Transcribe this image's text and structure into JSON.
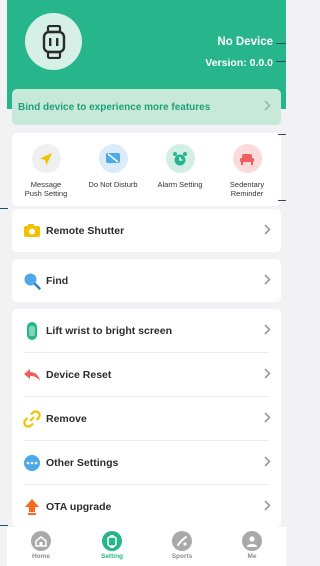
{
  "device": {
    "name": "No Device",
    "version": "Version: 0.0.0"
  },
  "bind_banner": {
    "text": "Bind device to experience more features"
  },
  "quick_actions": [
    {
      "label_line1": "Message",
      "label_line2": "Push Setting",
      "icon": "send-icon",
      "color": "#f2c200"
    },
    {
      "label_line1": "Do Not Disturb",
      "label_line2": "",
      "icon": "no-message-icon",
      "color": "#4da9e8"
    },
    {
      "label_line1": "Alarm Setting",
      "label_line2": "",
      "icon": "alarm-clock-icon",
      "color": "#27b58c"
    },
    {
      "label_line1": "Sedentary",
      "label_line2": "Reminder",
      "icon": "armchair-icon",
      "color": "#ef5f5f"
    }
  ],
  "menu": {
    "remote_shutter": "Remote Shutter",
    "find": "Find",
    "lift_wrist": "Lift wrist to bright screen",
    "device_reset": "Device Reset",
    "remove": "Remove",
    "other_settings": "Other Settings",
    "ota_upgrade": "OTA upgrade"
  },
  "tabs": [
    {
      "label": "Home",
      "icon": "home-icon",
      "active": false
    },
    {
      "label": "Setting",
      "icon": "watch-icon",
      "active": true
    },
    {
      "label": "Sports",
      "icon": "sports-icon",
      "active": false
    },
    {
      "label": "Me",
      "icon": "person-icon",
      "active": false
    }
  ],
  "colors": {
    "accent": "#27b58c",
    "banner_bg": "#c6e9da",
    "page_bg": "#f2f2f4"
  }
}
